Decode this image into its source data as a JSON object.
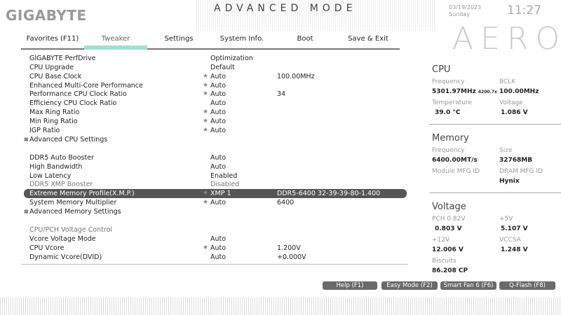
{
  "header": {
    "brand": "GIGABYTE",
    "mode": "ADVANCED MODE",
    "date": "03/19/2023",
    "day": "Sunday",
    "time": "11:27",
    "series_logo": "AERO"
  },
  "tabs": [
    {
      "label": "Favorites (F11)"
    },
    {
      "label": "Tweaker",
      "active": true
    },
    {
      "label": "Settings"
    },
    {
      "label": "System Info."
    },
    {
      "label": "Boot"
    },
    {
      "label": "Save & Exit"
    }
  ],
  "settings": [
    {
      "label": "GIGABYTE PerfDrive",
      "value": "Optimization",
      "star": false,
      "extra": ""
    },
    {
      "label": "CPU Upgrade",
      "value": "Default",
      "star": false,
      "extra": ""
    },
    {
      "label": "CPU Base Clock",
      "value": "Auto",
      "star": true,
      "extra": "100.00MHz"
    },
    {
      "label": "Enhanced Multi-Core Performance",
      "value": "Auto",
      "star": true,
      "extra": ""
    },
    {
      "label": "Performance CPU Clock Ratio",
      "value": "Auto",
      "star": true,
      "extra": "34"
    },
    {
      "label": "Efficiency CPU Clock Ratio",
      "value": "Auto",
      "star": false,
      "extra": ""
    },
    {
      "label": "Max Ring Ratio",
      "value": "Auto",
      "star": true,
      "extra": ""
    },
    {
      "label": "Min Ring Ratio",
      "value": "Auto",
      "star": true,
      "extra": ""
    },
    {
      "label": "IGP Ratio",
      "value": "Auto",
      "star": true,
      "extra": ""
    },
    {
      "label": "Advanced CPU Settings",
      "submenu": true
    },
    {
      "label": "DDR5 Auto Booster",
      "value": "Auto",
      "star": false,
      "extra": ""
    },
    {
      "label": "High Bandwidth",
      "value": "Auto",
      "star": false,
      "extra": ""
    },
    {
      "label": "Low Latency",
      "value": "Enabled",
      "star": false,
      "extra": ""
    },
    {
      "label": "DDR5 XMP Booster",
      "value": "Disabled",
      "star": false,
      "extra": "",
      "disabled": true
    },
    {
      "label": "Extreme Memory Profile(X.M.P.)",
      "value": "XMP 1",
      "star": true,
      "extra": "DDR5-6400 32-39-39-80-1.400",
      "selected": true
    },
    {
      "label": "System Memory Multiplier",
      "value": "Auto",
      "star": true,
      "extra": "6400"
    },
    {
      "label": "Advanced Memory Settings",
      "submenu": true
    },
    {
      "label": "CPU/PCH Voltage Control",
      "section": true
    },
    {
      "label": "Vcore Voltage Mode",
      "value": "Auto",
      "star": false,
      "extra": ""
    },
    {
      "label": "CPU Vcore",
      "value": "Auto",
      "star": true,
      "extra": "1.200V"
    },
    {
      "label": "Dynamic Vcore(DVID)",
      "value": "Auto",
      "star": false,
      "extra": "+0.000V"
    }
  ],
  "cpu": {
    "title": "CPU",
    "freq_label": "Frequency",
    "freq": "5301.97MHz",
    "freq_sub": "4200.7x",
    "bclk_label": "BCLK",
    "bclk": "100.00MHz",
    "temp_label": "Temperature",
    "temp": "39.0 °C",
    "volt_label": "Voltage",
    "volt": "1.086 V"
  },
  "memory": {
    "title": "Memory",
    "freq_label": "Frequency",
    "freq": "6400.00MT/s",
    "size_label": "Size",
    "size": "32768MB",
    "module_label": "Module MFG ID",
    "dram_label": "DRAM MFG ID",
    "dram": "Hynix"
  },
  "voltage": {
    "title": "Voltage",
    "pch_label": "PCH 0.82V",
    "pch": "0.803 V",
    "p5_label": "+5V",
    "p5": "5.107 V",
    "p12_label": "+12V",
    "p12": "12.006 V",
    "vccsa_label": "VCCSA",
    "vccsa": "1.248 V",
    "biscuits_label": "Biscuits",
    "biscuits": "86.208 CP"
  },
  "buttons": [
    {
      "label": "Help (F1)"
    },
    {
      "label": "Easy Mode (F2)"
    },
    {
      "label": "Smart Fan 6 (F6)"
    },
    {
      "label": "Q-Flash (F8)"
    }
  ],
  "colors": {
    "tab_active": "#9fe0d4",
    "selected_row": "#555555"
  }
}
